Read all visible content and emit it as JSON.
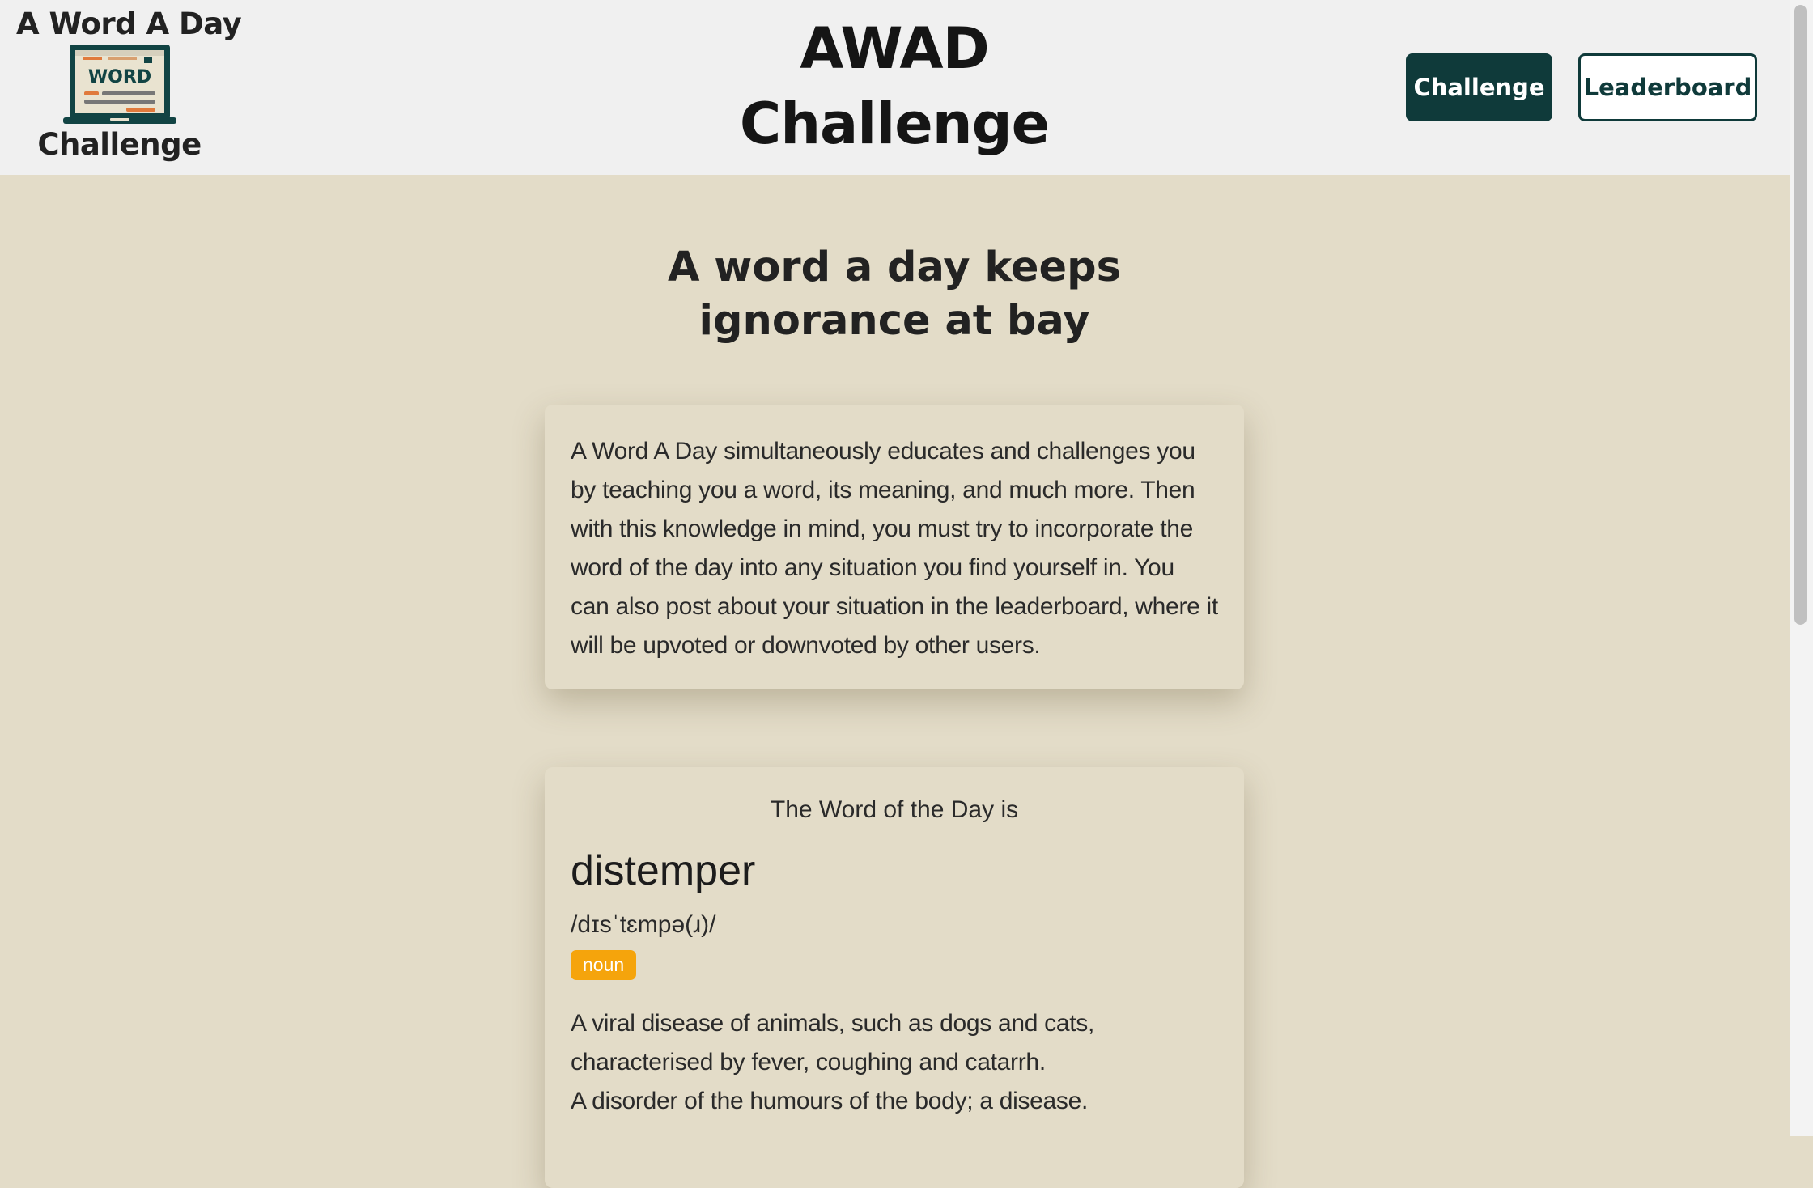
{
  "header": {
    "logo": {
      "top_text": "A Word A Day",
      "icon_word": "WORD",
      "bottom_text": "Challenge"
    },
    "site_title_line1": "AWAD",
    "site_title_line2": "Challenge",
    "nav": {
      "challenge_label": "Challenge",
      "leaderboard_label": "Leaderboard"
    }
  },
  "main": {
    "tagline": "A word a day keeps ignorance at bay",
    "intro": "A Word A Day simultaneously educates and challenges you by teaching you a word, its meaning, and much more. Then with this knowledge in mind, you must try to incorporate the word of the day into any situation you find yourself in. You can also post about your situation in the leaderboard, where it will be upvoted or downvoted by other users.",
    "word_card": {
      "label": "The Word of the Day is",
      "word": "distemper",
      "pronunciation": "/dɪsˈtɛmpə(ɹ)/",
      "part_of_speech": "noun",
      "definitions": [
        "A viral disease of animals, such as dogs and cats, characterised by fever, coughing and catarrh.",
        "A disorder of the humours of the body; a disease."
      ]
    }
  },
  "colors": {
    "page_background": "#e3dcc8",
    "header_background": "#f0f0f0",
    "brand_dark_teal": "#0f3a3a",
    "badge_orange": "#f5a40c"
  },
  "icons": {
    "logo": "laptop-word-icon"
  }
}
